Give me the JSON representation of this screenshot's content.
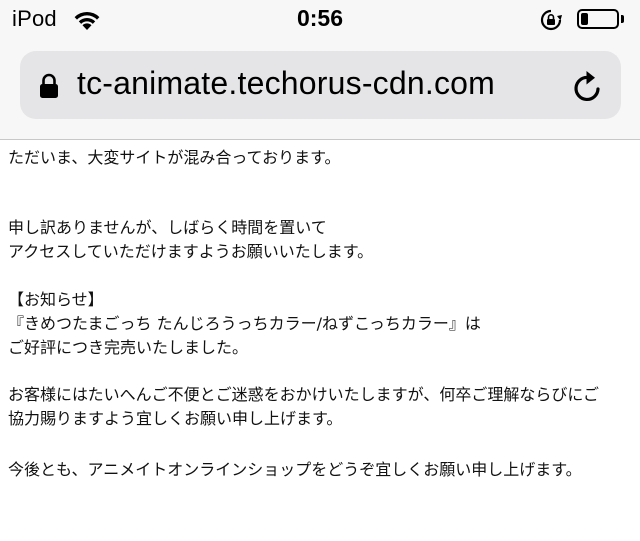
{
  "status_bar": {
    "carrier": "iPod",
    "time": "0:56",
    "battery_level": 0.2,
    "icons": [
      "wifi-icon",
      "rotation-lock-icon",
      "battery-icon"
    ]
  },
  "address_bar": {
    "url": "tc-animate.techorus-cdn.com",
    "icons": [
      "padlock-icon",
      "reload-icon"
    ]
  },
  "message": {
    "line1": "ただいま、大変サイトが混み合っております。",
    "apology": [
      "申し訳ありませんが、しばらく時間を置いて",
      "アクセスしていただけますようお願いいたします。"
    ],
    "notice": [
      "【お知らせ】",
      "『きめつたまごっち たんじろうっちカラー/ねずこっちカラー』は",
      "ご好評につき完売いたしました。"
    ],
    "inconvenience": [
      "お客様にはたいへんご不便とご迷惑をおかけいたしますが、何卒ご理解ならびにご",
      "協力賜りますよう宜しくお願い申し上げます。"
    ],
    "closing": "今後とも、アニメイトオンラインショップをどうぞ宜しくお願い申し上げます。"
  },
  "colors": {
    "chrome_background": "#f7f7f7",
    "address_bar_background": "#e5e5e7",
    "text": "#111111"
  }
}
